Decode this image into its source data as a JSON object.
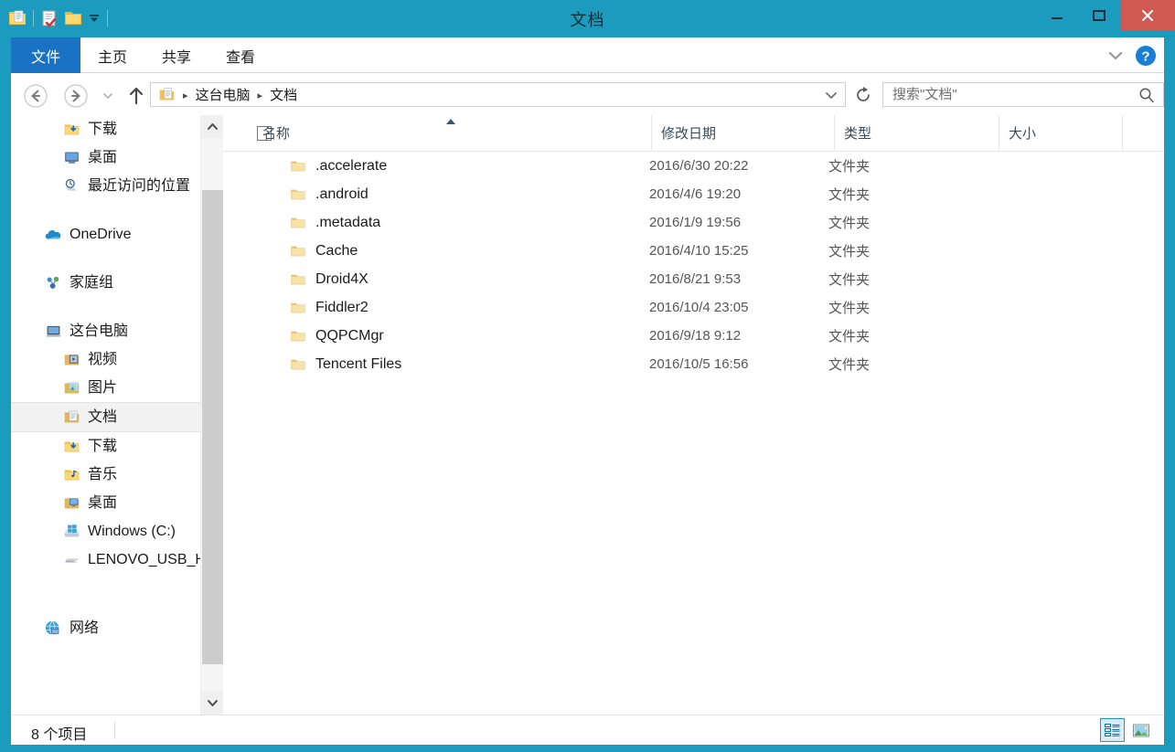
{
  "window": {
    "title": "文档",
    "accent_color": "#1b9bbd",
    "close_color": "#d05a52",
    "file_tab_color": "#1a72c4"
  },
  "quick_access": {
    "app_icon": "folder-document-icon",
    "items": [
      {
        "name": "properties-icon",
        "label": "属性"
      },
      {
        "name": "new-folder-icon",
        "label": "新建文件夹"
      }
    ],
    "customize": "自定义快速访问工具栏"
  },
  "window_controls": {
    "minimize": "最小化",
    "maximize": "最大化",
    "close": "关闭"
  },
  "ribbon": {
    "tabs": [
      {
        "label": "文件",
        "active": true
      },
      {
        "label": "主页",
        "active": false
      },
      {
        "label": "共享",
        "active": false
      },
      {
        "label": "查看",
        "active": false
      }
    ],
    "minimize_ribbon": "展开功能区",
    "help": "帮助"
  },
  "navbar": {
    "back": "后退",
    "forward": "前进",
    "history": "最近浏览的位置",
    "up": "上移到",
    "breadcrumb": {
      "icon": "documents-folder-icon",
      "parts": [
        "这台电脑",
        "文档"
      ],
      "separator": "▸"
    },
    "refresh": "刷新"
  },
  "search": {
    "placeholder": "搜索\"文档\"",
    "value": "",
    "icon": "search-icon"
  },
  "sidebar": {
    "groups": [
      {
        "items": [
          {
            "label": "下载",
            "icon": "downloads-folder-icon",
            "indent": 1,
            "selected": false
          },
          {
            "label": "桌面",
            "icon": "desktop-icon",
            "indent": 1,
            "selected": false
          },
          {
            "label": "最近访问的位置",
            "icon": "recent-places-icon",
            "indent": 1,
            "selected": false
          }
        ]
      },
      {
        "items": [
          {
            "label": "OneDrive",
            "icon": "onedrive-icon",
            "indent": 0,
            "selected": false
          }
        ]
      },
      {
        "items": [
          {
            "label": "家庭组",
            "icon": "homegroup-icon",
            "indent": 0,
            "selected": false
          }
        ]
      },
      {
        "items": [
          {
            "label": "这台电脑",
            "icon": "this-pc-icon",
            "indent": 0,
            "selected": false
          },
          {
            "label": "视频",
            "icon": "videos-folder-icon",
            "indent": 1,
            "selected": false
          },
          {
            "label": "图片",
            "icon": "pictures-folder-icon",
            "indent": 1,
            "selected": false
          },
          {
            "label": "文档",
            "icon": "documents-folder-icon",
            "indent": 1,
            "selected": true
          },
          {
            "label": "下载",
            "icon": "downloads-folder-icon",
            "indent": 1,
            "selected": false
          },
          {
            "label": "音乐",
            "icon": "music-folder-icon",
            "indent": 1,
            "selected": false
          },
          {
            "label": "桌面",
            "icon": "desktop-folder-icon",
            "indent": 1,
            "selected": false
          },
          {
            "label": "Windows (C:)",
            "icon": "windows-drive-icon",
            "indent": 1,
            "selected": false
          },
          {
            "label": "LENOVO_USB_H",
            "icon": "usb-drive-icon",
            "indent": 1,
            "selected": false
          }
        ]
      },
      {
        "items": [
          {
            "label": "网络",
            "icon": "network-icon",
            "indent": 0,
            "selected": false
          }
        ]
      }
    ]
  },
  "file_list": {
    "select_all_checkbox": {
      "name": "select-all-checkbox",
      "checked": false
    },
    "sort": {
      "column": "名称",
      "direction": "ascending"
    },
    "columns": [
      {
        "key": "name",
        "label": "名称"
      },
      {
        "key": "date",
        "label": "修改日期"
      },
      {
        "key": "type",
        "label": "类型"
      },
      {
        "key": "size",
        "label": "大小"
      }
    ],
    "rows": [
      {
        "name": ".accelerate",
        "date": "2016/6/30 20:22",
        "type": "文件夹",
        "size": "",
        "icon": "folder-icon"
      },
      {
        "name": ".android",
        "date": "2016/4/6 19:20",
        "type": "文件夹",
        "size": "",
        "icon": "folder-icon"
      },
      {
        "name": ".metadata",
        "date": "2016/1/9 19:56",
        "type": "文件夹",
        "size": "",
        "icon": "folder-icon"
      },
      {
        "name": "Cache",
        "date": "2016/4/10 15:25",
        "type": "文件夹",
        "size": "",
        "icon": "folder-icon"
      },
      {
        "name": "Droid4X",
        "date": "2016/8/21 9:53",
        "type": "文件夹",
        "size": "",
        "icon": "folder-icon"
      },
      {
        "name": "Fiddler2",
        "date": "2016/10/4 23:05",
        "type": "文件夹",
        "size": "",
        "icon": "folder-icon"
      },
      {
        "name": "QQPCMgr",
        "date": "2016/9/18 9:12",
        "type": "文件夹",
        "size": "",
        "icon": "folder-icon"
      },
      {
        "name": "Tencent Files",
        "date": "2016/10/5 16:56",
        "type": "文件夹",
        "size": "",
        "icon": "folder-icon"
      }
    ]
  },
  "status_bar": {
    "item_count": "8 个项目",
    "views": [
      {
        "name": "details-view-button",
        "label": "详细信息",
        "active": true
      },
      {
        "name": "large-icons-view-button",
        "label": "大图标",
        "active": false
      }
    ]
  }
}
